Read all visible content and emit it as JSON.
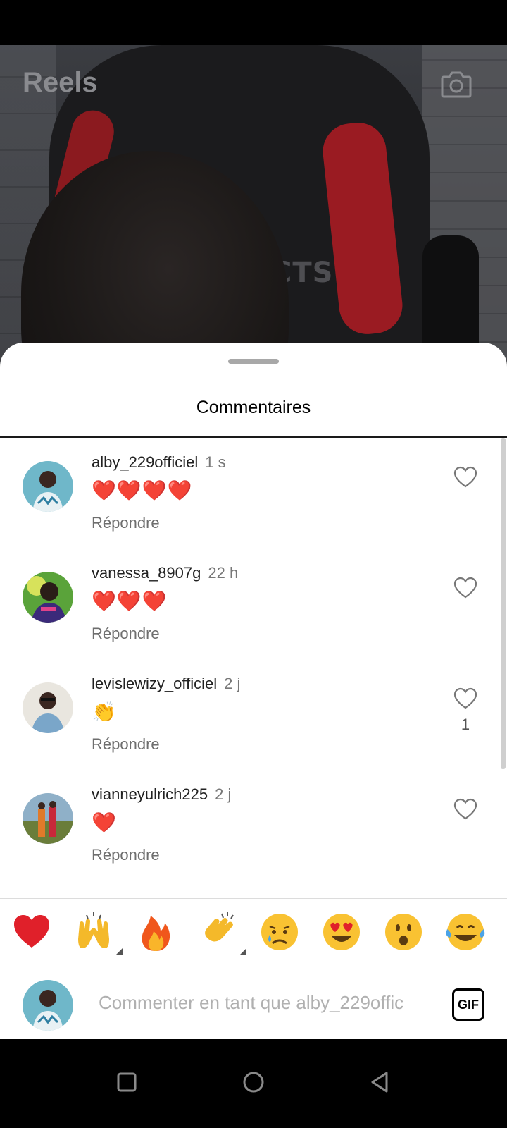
{
  "header": {
    "title": "Reels",
    "camera_icon": "camera-icon",
    "video_overlay_text": "CTS"
  },
  "sheet": {
    "title": "Commentaires"
  },
  "comments": [
    {
      "username": "alby_229officiel",
      "time": "1 s",
      "text": "❤️❤️❤️❤️",
      "reply_label": "Répondre",
      "likes": ""
    },
    {
      "username": "vanessa_8907g",
      "time": "22 h",
      "text": "❤️❤️❤️",
      "reply_label": "Répondre",
      "likes": ""
    },
    {
      "username": "levislewizy_officiel",
      "time": "2 j",
      "text": "👏",
      "reply_label": "Répondre",
      "likes": "1"
    },
    {
      "username": "vianneyulrich225",
      "time": "2 j",
      "text": "❤️",
      "reply_label": "Répondre",
      "likes": ""
    }
  ],
  "emoji_bar": [
    "❤️",
    "🙌",
    "🔥",
    "👏",
    "😢",
    "😍",
    "😮",
    "😂"
  ],
  "compose": {
    "placeholder": "Commenter en tant que alby_229offic",
    "gif_label": "GIF"
  },
  "nav": [
    "recents-icon",
    "home-icon",
    "back-icon"
  ],
  "colors": {
    "accent_heart": "#d81e25",
    "sheet_bg": "#ffffff",
    "muted_text": "#6e6e6e"
  }
}
